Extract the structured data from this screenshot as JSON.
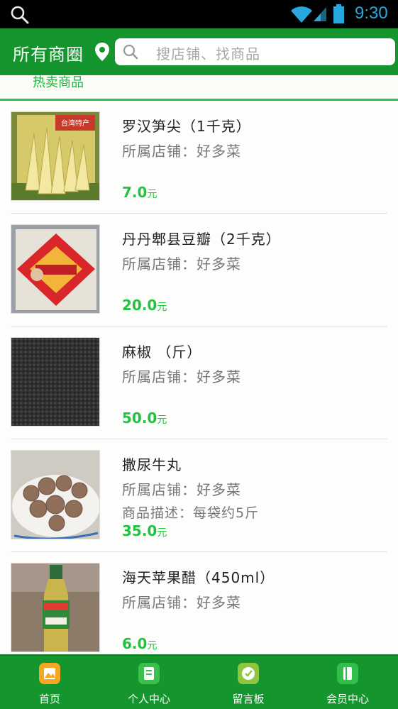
{
  "status_bar": {
    "time": "9:30"
  },
  "header": {
    "area_label": "所有商圈",
    "search_placeholder": "搜店铺、找商品"
  },
  "section": {
    "title": "热卖商品"
  },
  "products": [
    {
      "name": "罗汉笋尖（1千克）",
      "shop": "所属店铺：好多菜",
      "description": "",
      "price": "7.0",
      "unit": "元",
      "image": "bamboo-shoot-package"
    },
    {
      "name": "丹丹郫县豆瓣（2千克）",
      "shop": "所属店铺：好多菜",
      "description": "",
      "price": "20.0",
      "unit": "元",
      "image": "bean-paste-package"
    },
    {
      "name": "麻椒 （斤）",
      "shop": "所属店铺：好多菜",
      "description": "",
      "price": "50.0",
      "unit": "元",
      "image": "sichuan-pepper"
    },
    {
      "name": "撒尿牛丸",
      "shop": "所属店铺：好多菜",
      "description": "商品描述：每袋约5斤",
      "price": "35.0",
      "unit": "元",
      "image": "beef-balls"
    },
    {
      "name": "海天苹果醋（450ml）",
      "shop": "所属店铺：好多菜",
      "description": "",
      "price": "6.0",
      "unit": "元",
      "image": "apple-vinegar-bottle"
    }
  ],
  "bottom_nav": [
    {
      "label": "首页",
      "icon": "home-icon",
      "color": "#f5a623"
    },
    {
      "label": "个人中心",
      "icon": "profile-icon",
      "color": "#3cc04c"
    },
    {
      "label": "留言板",
      "icon": "message-board-icon",
      "color": "#8dc63f"
    },
    {
      "label": "会员中心",
      "icon": "member-card-icon",
      "color": "#2fbf4a"
    }
  ],
  "colors": {
    "brand_green": "#14952e",
    "price_green": "#22c340",
    "status_blue": "#29a8e0"
  }
}
